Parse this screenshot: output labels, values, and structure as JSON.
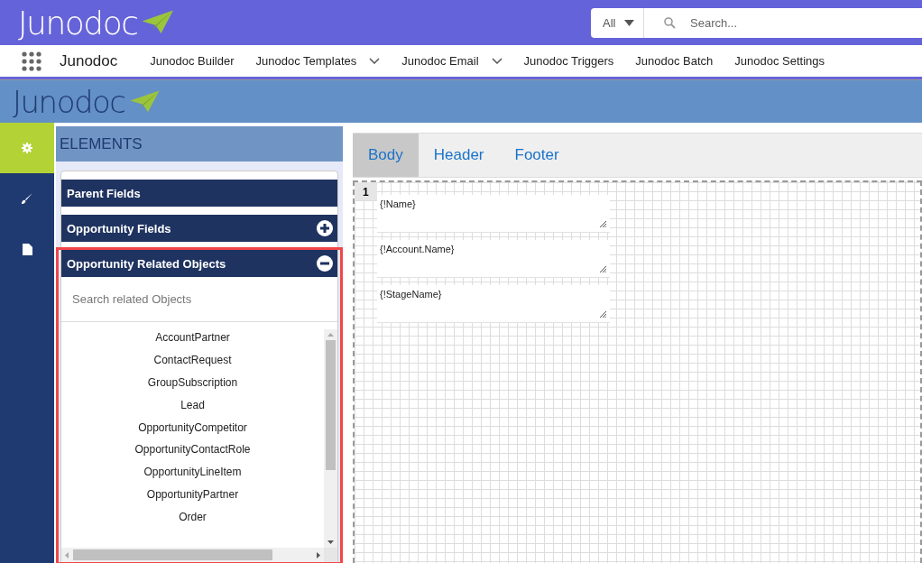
{
  "top_bar": {
    "logo": "Junodoc",
    "search": {
      "scope": "All",
      "placeholder": "Search..."
    }
  },
  "nav": {
    "app_name": "Junodoc",
    "items": [
      {
        "label": "Junodoc Builder",
        "dropdown": false
      },
      {
        "label": "Junodoc Templates",
        "dropdown": true
      },
      {
        "label": "Junodoc Email",
        "dropdown": true
      },
      {
        "label": "Junodoc Triggers",
        "dropdown": false
      },
      {
        "label": "Junodoc Batch",
        "dropdown": false
      },
      {
        "label": "Junodoc Settings",
        "dropdown": false
      }
    ]
  },
  "banner": {
    "logo": "Junodoc"
  },
  "rail": [
    {
      "kind": "gear",
      "selected": true
    },
    {
      "kind": "brush",
      "selected": false
    },
    {
      "kind": "document",
      "selected": false
    }
  ],
  "elements": {
    "title": "ELEMENTS",
    "sections": [
      {
        "title": "Parent Fields",
        "kind": "plain",
        "highlighted": false
      },
      {
        "title": "Opportunity Fields",
        "kind": "toggle",
        "expanded": false,
        "highlighted": false
      },
      {
        "title": "Opportunity Related Objects",
        "kind": "toggle",
        "expanded": true,
        "highlighted": true,
        "search_placeholder": "Search related Objects",
        "items": [
          "AccountPartner",
          "ContactRequest",
          "GroupSubscription",
          "Lead",
          "OpportunityCompetitor",
          "OpportunityContactRole",
          "OpportunityLineItem",
          "OpportunityPartner",
          "Order"
        ]
      }
    ]
  },
  "editor": {
    "tabs": [
      {
        "label": "Body",
        "selected": true
      },
      {
        "label": "Header",
        "selected": false
      },
      {
        "label": "Footer",
        "selected": false
      }
    ],
    "line_number": "1",
    "fields": [
      "{!Name}",
      "{!Account.Name}",
      "{!StageName}"
    ]
  }
}
